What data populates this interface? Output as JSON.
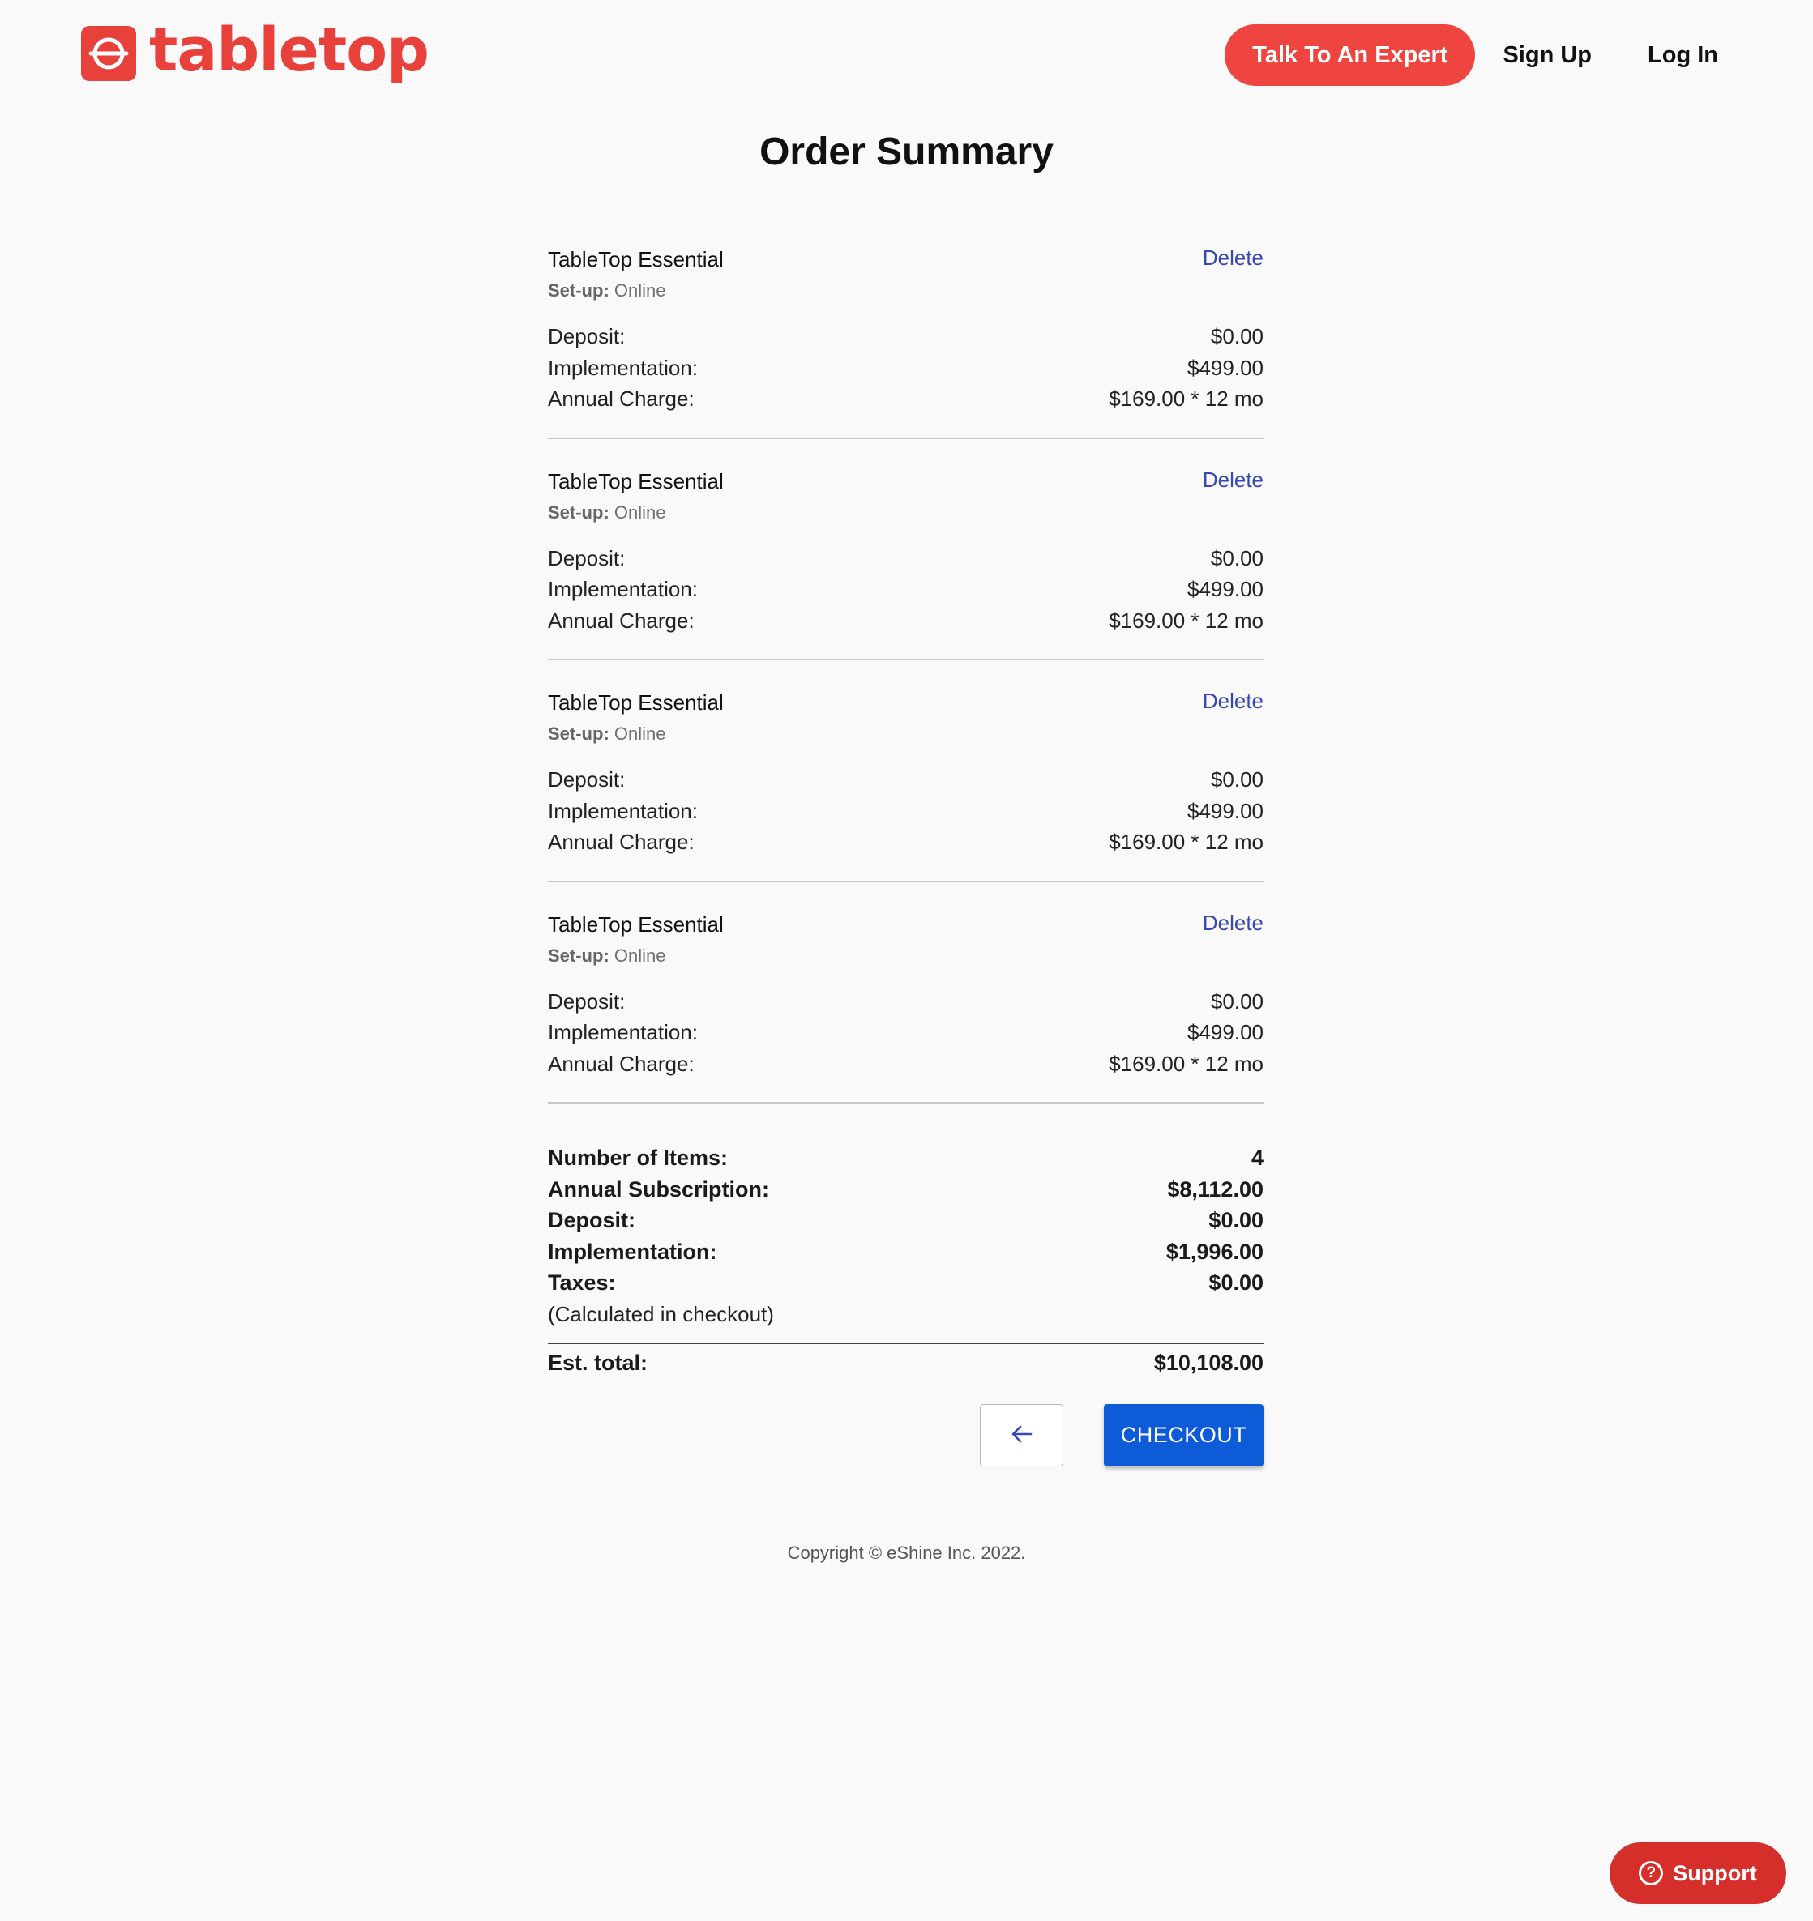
{
  "header": {
    "logo_text": "tabletop",
    "nav": {
      "expert": "Talk To An Expert",
      "signup": "Sign Up",
      "login": "Log In"
    }
  },
  "page": {
    "title": "Order Summary"
  },
  "items": [
    {
      "name": "TableTop Essential",
      "delete": "Delete",
      "setup_label": "Set-up:",
      "setup_value": "Online",
      "deposit_label": "Deposit:",
      "deposit": "$0.00",
      "implementation_label": "Implementation:",
      "implementation": "$499.00",
      "annual_label": "Annual Charge:",
      "annual": "$169.00 * 12 mo"
    },
    {
      "name": "TableTop Essential",
      "delete": "Delete",
      "setup_label": "Set-up:",
      "setup_value": "Online",
      "deposit_label": "Deposit:",
      "deposit": "$0.00",
      "implementation_label": "Implementation:",
      "implementation": "$499.00",
      "annual_label": "Annual Charge:",
      "annual": "$169.00 * 12 mo"
    },
    {
      "name": "TableTop Essential",
      "delete": "Delete",
      "setup_label": "Set-up:",
      "setup_value": "Online",
      "deposit_label": "Deposit:",
      "deposit": "$0.00",
      "implementation_label": "Implementation:",
      "implementation": "$499.00",
      "annual_label": "Annual Charge:",
      "annual": "$169.00 * 12 mo"
    },
    {
      "name": "TableTop Essential",
      "delete": "Delete",
      "setup_label": "Set-up:",
      "setup_value": "Online",
      "deposit_label": "Deposit:",
      "deposit": "$0.00",
      "implementation_label": "Implementation:",
      "implementation": "$499.00",
      "annual_label": "Annual Charge:",
      "annual": "$169.00 * 12 mo"
    }
  ],
  "summary": {
    "num_items_label": "Number of Items:",
    "num_items": "4",
    "annual_label": "Annual Subscription:",
    "annual": "$8,112.00",
    "deposit_label": "Deposit:",
    "deposit": "$0.00",
    "implementation_label": "Implementation:",
    "implementation": "$1,996.00",
    "taxes_label": "Taxes:",
    "taxes": "$0.00",
    "taxes_note": "(Calculated in checkout)",
    "total_label": "Est. total:",
    "total": "$10,108.00"
  },
  "actions": {
    "back_icon": "arrow-left-icon",
    "checkout": "CHECKOUT"
  },
  "footer": {
    "copyright": "Copyright © eShine Inc. 2022."
  },
  "support": {
    "icon": "help-circle-icon",
    "label": "Support"
  },
  "colors": {
    "brand_red": "#e8403a",
    "link_blue": "#3848b0",
    "checkout_blue": "#0d5bd7",
    "support_red": "#d62e2b"
  }
}
